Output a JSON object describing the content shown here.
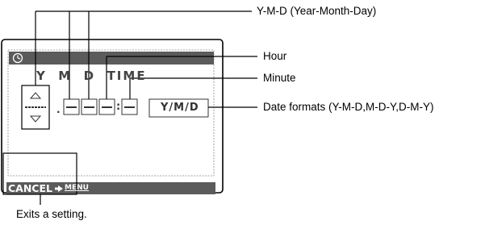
{
  "screen": {
    "clock_icon": "clock-icon",
    "header_label": "Y  M  D  TIME",
    "date_format_value": "Y/M/D",
    "separator_colon": ":",
    "separator_dot": ".",
    "placeholder_dash": "--",
    "cancel_label": "CANCEL",
    "menu_label": "MENU",
    "up_arrow_icon": "up-triangle-icon",
    "down_arrow_icon": "down-triangle-icon"
  },
  "callouts": {
    "ymd": "Y-M-D (Year-Month-Day)",
    "hour": "Hour",
    "minute": "Minute",
    "date_formats": "Date formats (Y-M-D,M-D-Y,D-M-Y)",
    "exit": "Exits a setting."
  }
}
